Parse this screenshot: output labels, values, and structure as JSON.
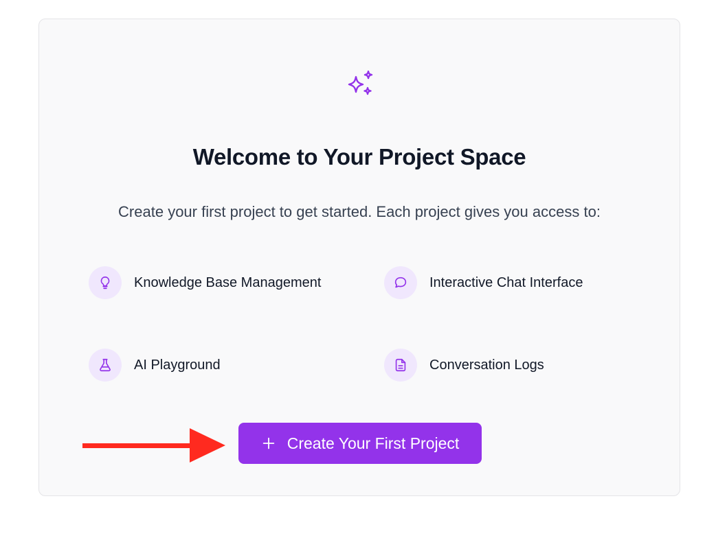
{
  "hero": {
    "icon": "sparkles-icon",
    "accent_color": "#9333ea"
  },
  "title": "Welcome to Your Project Space",
  "subtitle": "Create your first project to get started. Each project gives you access to:",
  "features": [
    {
      "label": "Knowledge Base Management",
      "icon": "lightbulb-icon"
    },
    {
      "label": "Interactive Chat Interface",
      "icon": "chat-bubble-icon"
    },
    {
      "label": "AI Playground",
      "icon": "flask-icon"
    },
    {
      "label": "Conversation Logs",
      "icon": "document-icon"
    }
  ],
  "cta": {
    "label": "Create Your First Project",
    "icon": "plus-icon",
    "color": "#9333ea"
  },
  "annotation": {
    "arrow_color": "#ff2a1f"
  }
}
